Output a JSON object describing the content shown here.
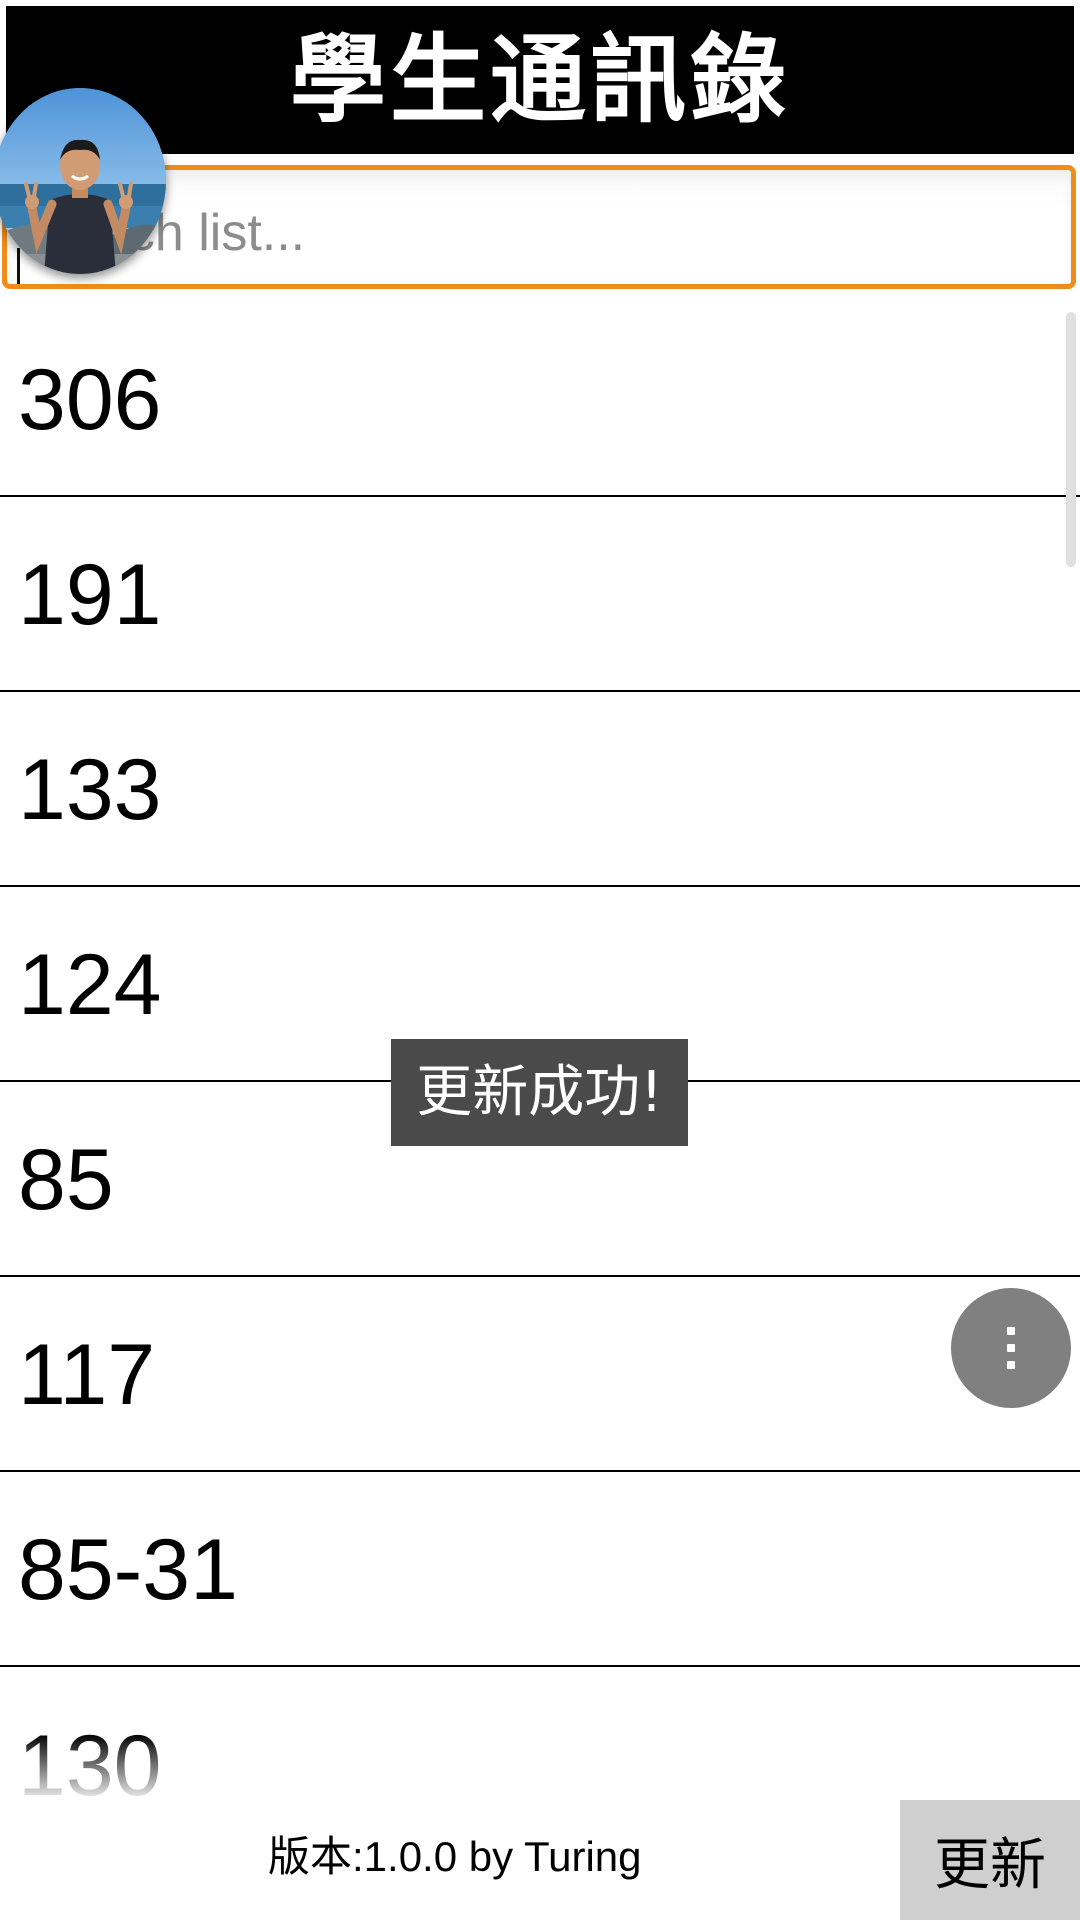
{
  "header": {
    "title": "學生通訊錄"
  },
  "search": {
    "placeholder": "Search list..."
  },
  "list": {
    "items": [
      {
        "label": "306"
      },
      {
        "label": "191"
      },
      {
        "label": "133"
      },
      {
        "label": "124"
      },
      {
        "label": "85"
      },
      {
        "label": "117"
      },
      {
        "label": "85-31"
      },
      {
        "label": "130"
      }
    ]
  },
  "toast": {
    "text": "更新成功!"
  },
  "fab": {
    "icon": "more-vert-icon"
  },
  "footer": {
    "version": "版本:1.0.0 by Turing",
    "refresh_label": "更新"
  },
  "colors": {
    "header_bg": "#000000",
    "search_border": "#f08c1a",
    "toast_bg": "#4a4a4a",
    "fab_bg": "#808080",
    "refresh_bg": "#cfcfcf"
  }
}
